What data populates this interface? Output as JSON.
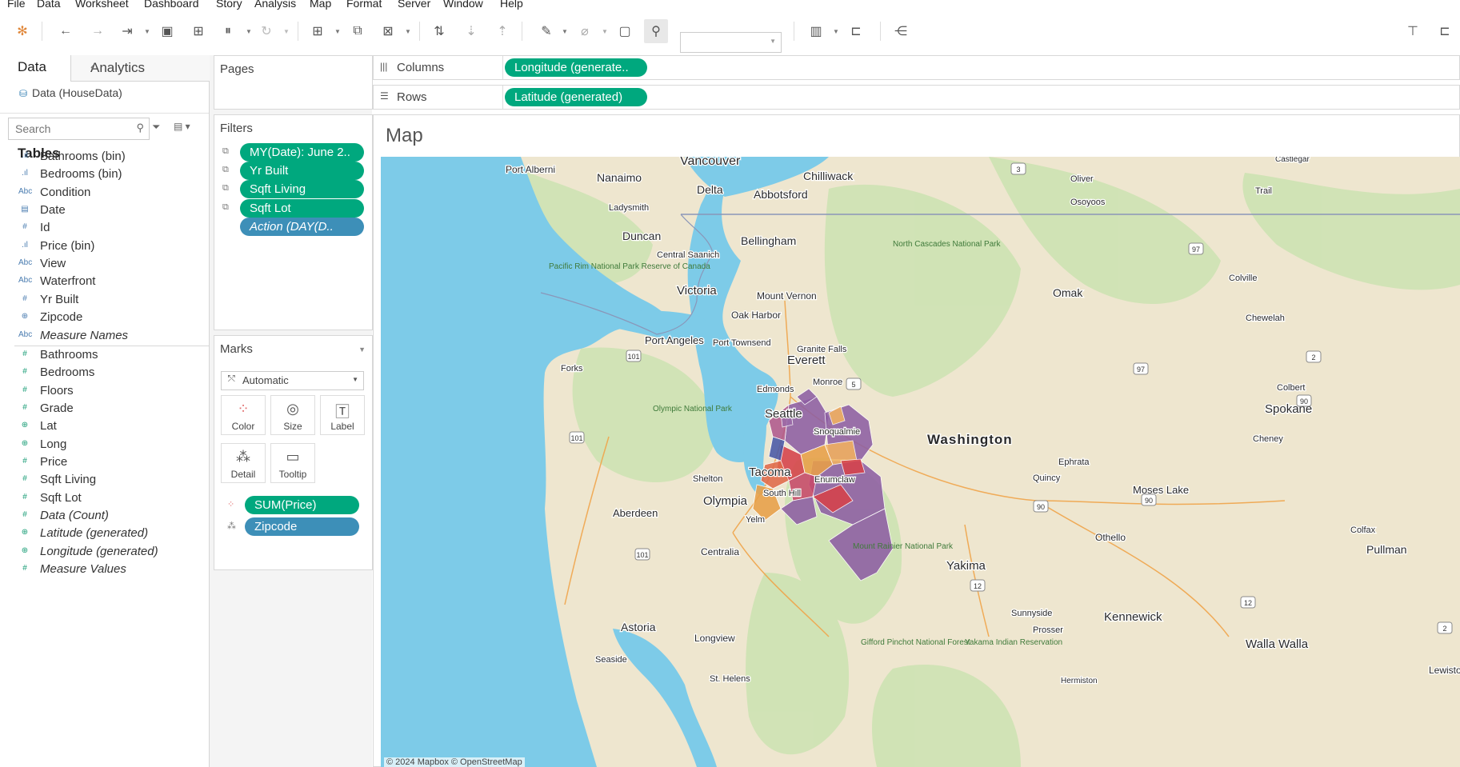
{
  "menubar": {
    "items": [
      "File",
      "Data",
      "Worksheet",
      "Dashboard",
      "Story",
      "Analysis",
      "Map",
      "Format",
      "Server",
      "Window",
      "Help"
    ]
  },
  "toolbar": {
    "icons": [
      "tableau-logo-icon",
      "back-icon",
      "forward-icon",
      "redo-icon",
      "save-icon",
      "new-datasource-icon",
      "pause-updates-icon",
      "refresh-icon",
      "new-worksheet-icon",
      "duplicate-sheet-icon",
      "clear-sheet-icon",
      "swap-rows-columns-icon",
      "sort-ascending-icon",
      "sort-descending-icon",
      "highlight-icon",
      "group-members-icon",
      "show-labels-icon",
      "fix-axes-icon",
      "fit-combo",
      "show-me-icon",
      "presentation-mode-icon",
      "share-icon",
      "show-me-panel-icon"
    ],
    "fit_value": ""
  },
  "datapane": {
    "tab_data": "Data",
    "tab_analytics": "Analytics",
    "datasource": "Data (HouseData)",
    "search_placeholder": "Search",
    "tables_header": "Tables",
    "fields": [
      {
        "type": "Abc-bin",
        "name": "Bathrooms (bin)",
        "role": "dim",
        "icon": "bin-icon",
        "glyph": ".ıl"
      },
      {
        "type": "bin",
        "name": "Bedrooms (bin)",
        "role": "dim",
        "icon": "bin-icon",
        "glyph": ".ıl"
      },
      {
        "type": "abc",
        "name": "Condition",
        "role": "dim",
        "icon": "string-icon",
        "glyph": "Abc"
      },
      {
        "type": "date",
        "name": "Date",
        "role": "dim",
        "icon": "date-icon",
        "glyph": "▤"
      },
      {
        "type": "num",
        "name": "Id",
        "role": "dim",
        "icon": "number-icon",
        "glyph": "#"
      },
      {
        "type": "bin",
        "name": "Price (bin)",
        "role": "dim",
        "icon": "bin-icon",
        "glyph": ".ıl"
      },
      {
        "type": "abc",
        "name": "View",
        "role": "dim",
        "icon": "string-icon",
        "glyph": "Abc"
      },
      {
        "type": "abc",
        "name": "Waterfront",
        "role": "dim",
        "icon": "string-icon",
        "glyph": "Abc"
      },
      {
        "type": "num",
        "name": "Yr Built",
        "role": "dim",
        "icon": "number-icon",
        "glyph": "#"
      },
      {
        "type": "geo",
        "name": "Zipcode",
        "role": "dim",
        "icon": "geo-icon",
        "glyph": "⊕"
      },
      {
        "type": "abc",
        "name": "Measure Names",
        "role": "dim",
        "icon": "string-icon",
        "glyph": "Abc",
        "italic": true
      },
      {
        "type": "num",
        "name": "Bathrooms",
        "role": "mea",
        "icon": "number-icon",
        "glyph": "#"
      },
      {
        "type": "num",
        "name": "Bedrooms",
        "role": "mea",
        "icon": "number-icon",
        "glyph": "#"
      },
      {
        "type": "num",
        "name": "Floors",
        "role": "mea",
        "icon": "number-icon",
        "glyph": "#"
      },
      {
        "type": "num",
        "name": "Grade",
        "role": "mea",
        "icon": "number-icon",
        "glyph": "#"
      },
      {
        "type": "geo",
        "name": "Lat",
        "role": "mea",
        "icon": "geo-icon",
        "glyph": "⊕"
      },
      {
        "type": "geo",
        "name": "Long",
        "role": "mea",
        "icon": "geo-icon",
        "glyph": "⊕"
      },
      {
        "type": "num",
        "name": "Price",
        "role": "mea",
        "icon": "number-icon",
        "glyph": "#"
      },
      {
        "type": "num",
        "name": "Sqft Living",
        "role": "mea",
        "icon": "number-icon",
        "glyph": "#"
      },
      {
        "type": "num",
        "name": "Sqft Lot",
        "role": "mea",
        "icon": "number-icon",
        "glyph": "#"
      },
      {
        "type": "num",
        "name": "Data (Count)",
        "role": "mea",
        "icon": "number-icon",
        "glyph": "#",
        "italic": true
      },
      {
        "type": "geo",
        "name": "Latitude (generated)",
        "role": "mea",
        "icon": "geo-icon",
        "glyph": "⊕",
        "italic": true
      },
      {
        "type": "geo",
        "name": "Longitude (generated)",
        "role": "mea",
        "icon": "geo-icon",
        "glyph": "⊕",
        "italic": true
      },
      {
        "type": "num",
        "name": "Measure Values",
        "role": "mea",
        "icon": "number-icon",
        "glyph": "#",
        "italic": true
      }
    ]
  },
  "pages": {
    "title": "Pages"
  },
  "filters": {
    "title": "Filters",
    "pills": [
      {
        "label": "MY(Date): June 2..",
        "color": "green",
        "italic": false
      },
      {
        "label": "Yr Built",
        "color": "green",
        "italic": false
      },
      {
        "label": "Sqft Living",
        "color": "green",
        "italic": false
      },
      {
        "label": "Sqft Lot",
        "color": "green",
        "italic": false
      },
      {
        "label": "Action (DAY(D..",
        "color": "blue",
        "italic": true
      }
    ]
  },
  "marks": {
    "title": "Marks",
    "type": "Automatic",
    "buttons": [
      "Color",
      "Size",
      "Label",
      "Detail",
      "Tooltip"
    ],
    "pills": [
      {
        "label": "SUM(Price)",
        "color": "green",
        "icon": "color-icon"
      },
      {
        "label": "Zipcode",
        "color": "blue",
        "icon": "detail-icon"
      }
    ]
  },
  "columns": {
    "label": "Columns",
    "pill": "Longitude (generate.."
  },
  "rows": {
    "label": "Rows",
    "pill": "Latitude (generated)"
  },
  "view": {
    "title": "Map",
    "attribution": "© 2024 Mapbox © OpenStreetMap"
  },
  "map": {
    "colors": {
      "water": "#7dcbe8",
      "land": "#eee6cf",
      "forest": "#cfe3b4",
      "border": "#8a96b8",
      "road": "#f0a44a"
    },
    "place_labels": [
      {
        "text": "Vancouver",
        "size": 16
      },
      {
        "text": "Port Alberni",
        "size": 12
      },
      {
        "text": "Nanaimo",
        "size": 14
      },
      {
        "text": "Delta",
        "size": 14
      },
      {
        "text": "Chilliwack",
        "size": 14
      },
      {
        "text": "Abbotsford",
        "size": 14
      },
      {
        "text": "Ladysmith",
        "size": 11
      },
      {
        "text": "Duncan",
        "size": 14
      },
      {
        "text": "Bellingham",
        "size": 14
      },
      {
        "text": "Central Saanich",
        "size": 11
      },
      {
        "text": "Victoria",
        "size": 15
      },
      {
        "text": "Oliver",
        "size": 11
      },
      {
        "text": "Osoyoos",
        "size": 11
      },
      {
        "text": "Trail",
        "size": 11
      },
      {
        "text": "Castlegar",
        "size": 10
      },
      {
        "text": "Colville",
        "size": 11
      },
      {
        "text": "Omak",
        "size": 14
      },
      {
        "text": "Chewelah",
        "size": 11
      },
      {
        "text": "Mount Vernon",
        "size": 12
      },
      {
        "text": "Oak Harbor",
        "size": 12
      },
      {
        "text": "Port Angeles",
        "size": 13
      },
      {
        "text": "Port Townsend",
        "size": 11
      },
      {
        "text": "Granite Falls",
        "size": 11
      },
      {
        "text": "Everett",
        "size": 15
      },
      {
        "text": "Forks",
        "size": 11
      },
      {
        "text": "Monroe",
        "size": 11
      },
      {
        "text": "Edmonds",
        "size": 11
      },
      {
        "text": "Seattle",
        "size": 15
      },
      {
        "text": "Snoqualmie",
        "size": 11
      },
      {
        "text": "Washington",
        "size": 17
      },
      {
        "text": "Spokane",
        "size": 15
      },
      {
        "text": "Colbert",
        "size": 11
      },
      {
        "text": "Cheney",
        "size": 11
      },
      {
        "text": "Ephrata",
        "size": 11
      },
      {
        "text": "Quincy",
        "size": 11
      },
      {
        "text": "Moses Lake",
        "size": 13
      },
      {
        "text": "Shelton",
        "size": 11
      },
      {
        "text": "Tacoma",
        "size": 15
      },
      {
        "text": "Enumclaw",
        "size": 11
      },
      {
        "text": "South Hill",
        "size": 11
      },
      {
        "text": "Olympia",
        "size": 15
      },
      {
        "text": "Aberdeen",
        "size": 13
      },
      {
        "text": "Yelm",
        "size": 11
      },
      {
        "text": "Centralia",
        "size": 12
      },
      {
        "text": "Othello",
        "size": 12
      },
      {
        "text": "Colfax",
        "size": 11
      },
      {
        "text": "Pullman",
        "size": 14
      },
      {
        "text": "Yakima",
        "size": 15
      },
      {
        "text": "Sunnyside",
        "size": 11
      },
      {
        "text": "Prosser",
        "size": 11
      },
      {
        "text": "Kennewick",
        "size": 15
      },
      {
        "text": "Walla Walla",
        "size": 15
      },
      {
        "text": "Astoria",
        "size": 14
      },
      {
        "text": "Longview",
        "size": 12
      },
      {
        "text": "Seaside",
        "size": 11
      },
      {
        "text": "St. Helens",
        "size": 11
      },
      {
        "text": "Hermiston",
        "size": 10
      },
      {
        "text": "Lewiston",
        "size": 12
      }
    ],
    "park_labels": [
      {
        "text": "Pacific Rim National Park Reserve of Canada"
      },
      {
        "text": "North Cascades National Park"
      },
      {
        "text": "Olympic National Park"
      },
      {
        "text": "Mount Rainier National Park"
      },
      {
        "text": "Gifford Pinchot National Forest"
      },
      {
        "text": "Yakama Indian Reservation"
      }
    ],
    "shields": [
      "3",
      "97",
      "97",
      "5",
      "101",
      "101",
      "2",
      "90",
      "90",
      "90",
      "101",
      "12",
      "12",
      "2"
    ],
    "zipcode_fill_colors": [
      "#8e5fa3",
      "#b05a8e",
      "#d6424a",
      "#e8a048",
      "#f2b260",
      "#4a5aa8",
      "#e06a4a",
      "#9b6aa8",
      "#c94a6a"
    ]
  }
}
